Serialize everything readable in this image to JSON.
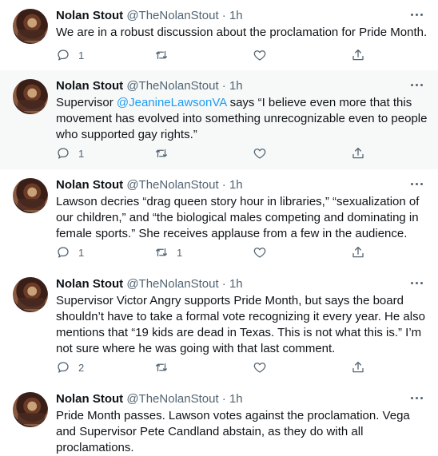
{
  "tweets": [
    {
      "name": "Nolan Stout",
      "handle": "@TheNolanStout",
      "time": "1h",
      "text_before": "We are in a robust discussion about the proclamation for Pride Month.",
      "mention": "",
      "text_after": "",
      "reply_count": "1",
      "retweet_count": "",
      "like_count": ""
    },
    {
      "name": "Nolan Stout",
      "handle": "@TheNolanStout",
      "time": "1h",
      "text_before": "Supervisor ",
      "mention": "@JeanineLawsonVA",
      "text_after": " says “I believe even more that this movement has evolved into something unrecognizable even to people who supported gay rights.”",
      "reply_count": "1",
      "retweet_count": "",
      "like_count": ""
    },
    {
      "name": "Nolan Stout",
      "handle": "@TheNolanStout",
      "time": "1h",
      "text_before": "Lawson decries “drag queen story hour in libraries,” “sexualization of our children,” and “the biological males competing and dominating in female sports.” She receives applause from a few in the audience.",
      "mention": "",
      "text_after": "",
      "reply_count": "1",
      "retweet_count": "1",
      "like_count": ""
    },
    {
      "name": "Nolan Stout",
      "handle": "@TheNolanStout",
      "time": "1h",
      "text_before": "Supervisor Victor Angry supports Pride Month, but says the board shouldn’t have to take a formal vote recognizing it every year. He also mentions that “19 kids are dead in Texas. This is not what this is.” I’m not sure where he was going with that last comment.",
      "mention": "",
      "text_after": "",
      "reply_count": "2",
      "retweet_count": "",
      "like_count": ""
    },
    {
      "name": "Nolan Stout",
      "handle": "@TheNolanStout",
      "time": "1h",
      "text_before": "Pride Month passes. Lawson votes against the proclamation. Vega and Supervisor Pete Candland abstain, as they do with all proclamations.",
      "mention": "",
      "text_after": "",
      "reply_count": "",
      "retweet_count": "",
      "like_count": ""
    }
  ],
  "separator": "·"
}
